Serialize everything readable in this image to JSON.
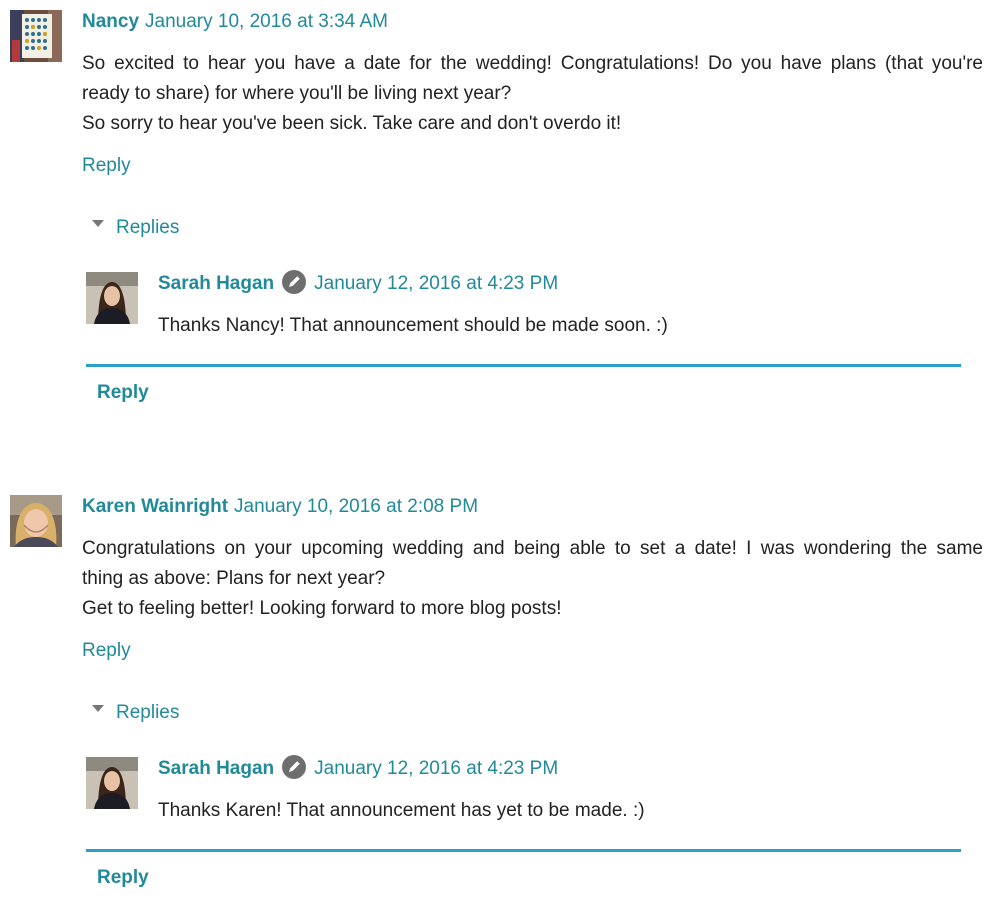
{
  "comments": [
    {
      "author": "Nancy",
      "timestamp": "January 10, 2016 at 3:34 AM",
      "avatar_icon": "board-game-avatar-icon",
      "body_lines": [
        "So excited to hear you have a date for the wedding! Congratulations! Do you have plans (that you're",
        "ready to share) for where you'll be living next year?",
        "So sorry to hear you've been sick. Take care and don't overdo it!"
      ],
      "reply_label": "Reply",
      "replies_label": "Replies",
      "replies": [
        {
          "author": "Sarah Hagan",
          "author_badge_icon": "pencil-icon",
          "timestamp": "January 12, 2016 at 4:23 PM",
          "avatar_icon": "person-avatar-icon",
          "body": "Thanks Nancy! That announcement should be made soon. :)"
        }
      ],
      "thread_reply_label": "Reply"
    },
    {
      "author": "Karen Wainright",
      "timestamp": "January 10, 2016 at 2:08 PM",
      "avatar_icon": "person-avatar-icon",
      "body_lines": [
        "Congratulations on your upcoming wedding and being able to set a date! I was wondering the same",
        "thing as above: Plans for next year?",
        "Get to feeling better! Looking forward to more blog posts!"
      ],
      "reply_label": "Reply",
      "replies_label": "Replies",
      "replies": [
        {
          "author": "Sarah Hagan",
          "author_badge_icon": "pencil-icon",
          "timestamp": "January 12, 2016 at 4:23 PM",
          "avatar_icon": "person-avatar-icon",
          "body": "Thanks Karen! That announcement has yet to be made. :)"
        }
      ],
      "thread_reply_label": "Reply"
    }
  ],
  "colors": {
    "link": "#218a99",
    "divider": "#2b9fc5",
    "text": "#222222",
    "caret": "#777777",
    "badge": "#6e6e6e"
  }
}
